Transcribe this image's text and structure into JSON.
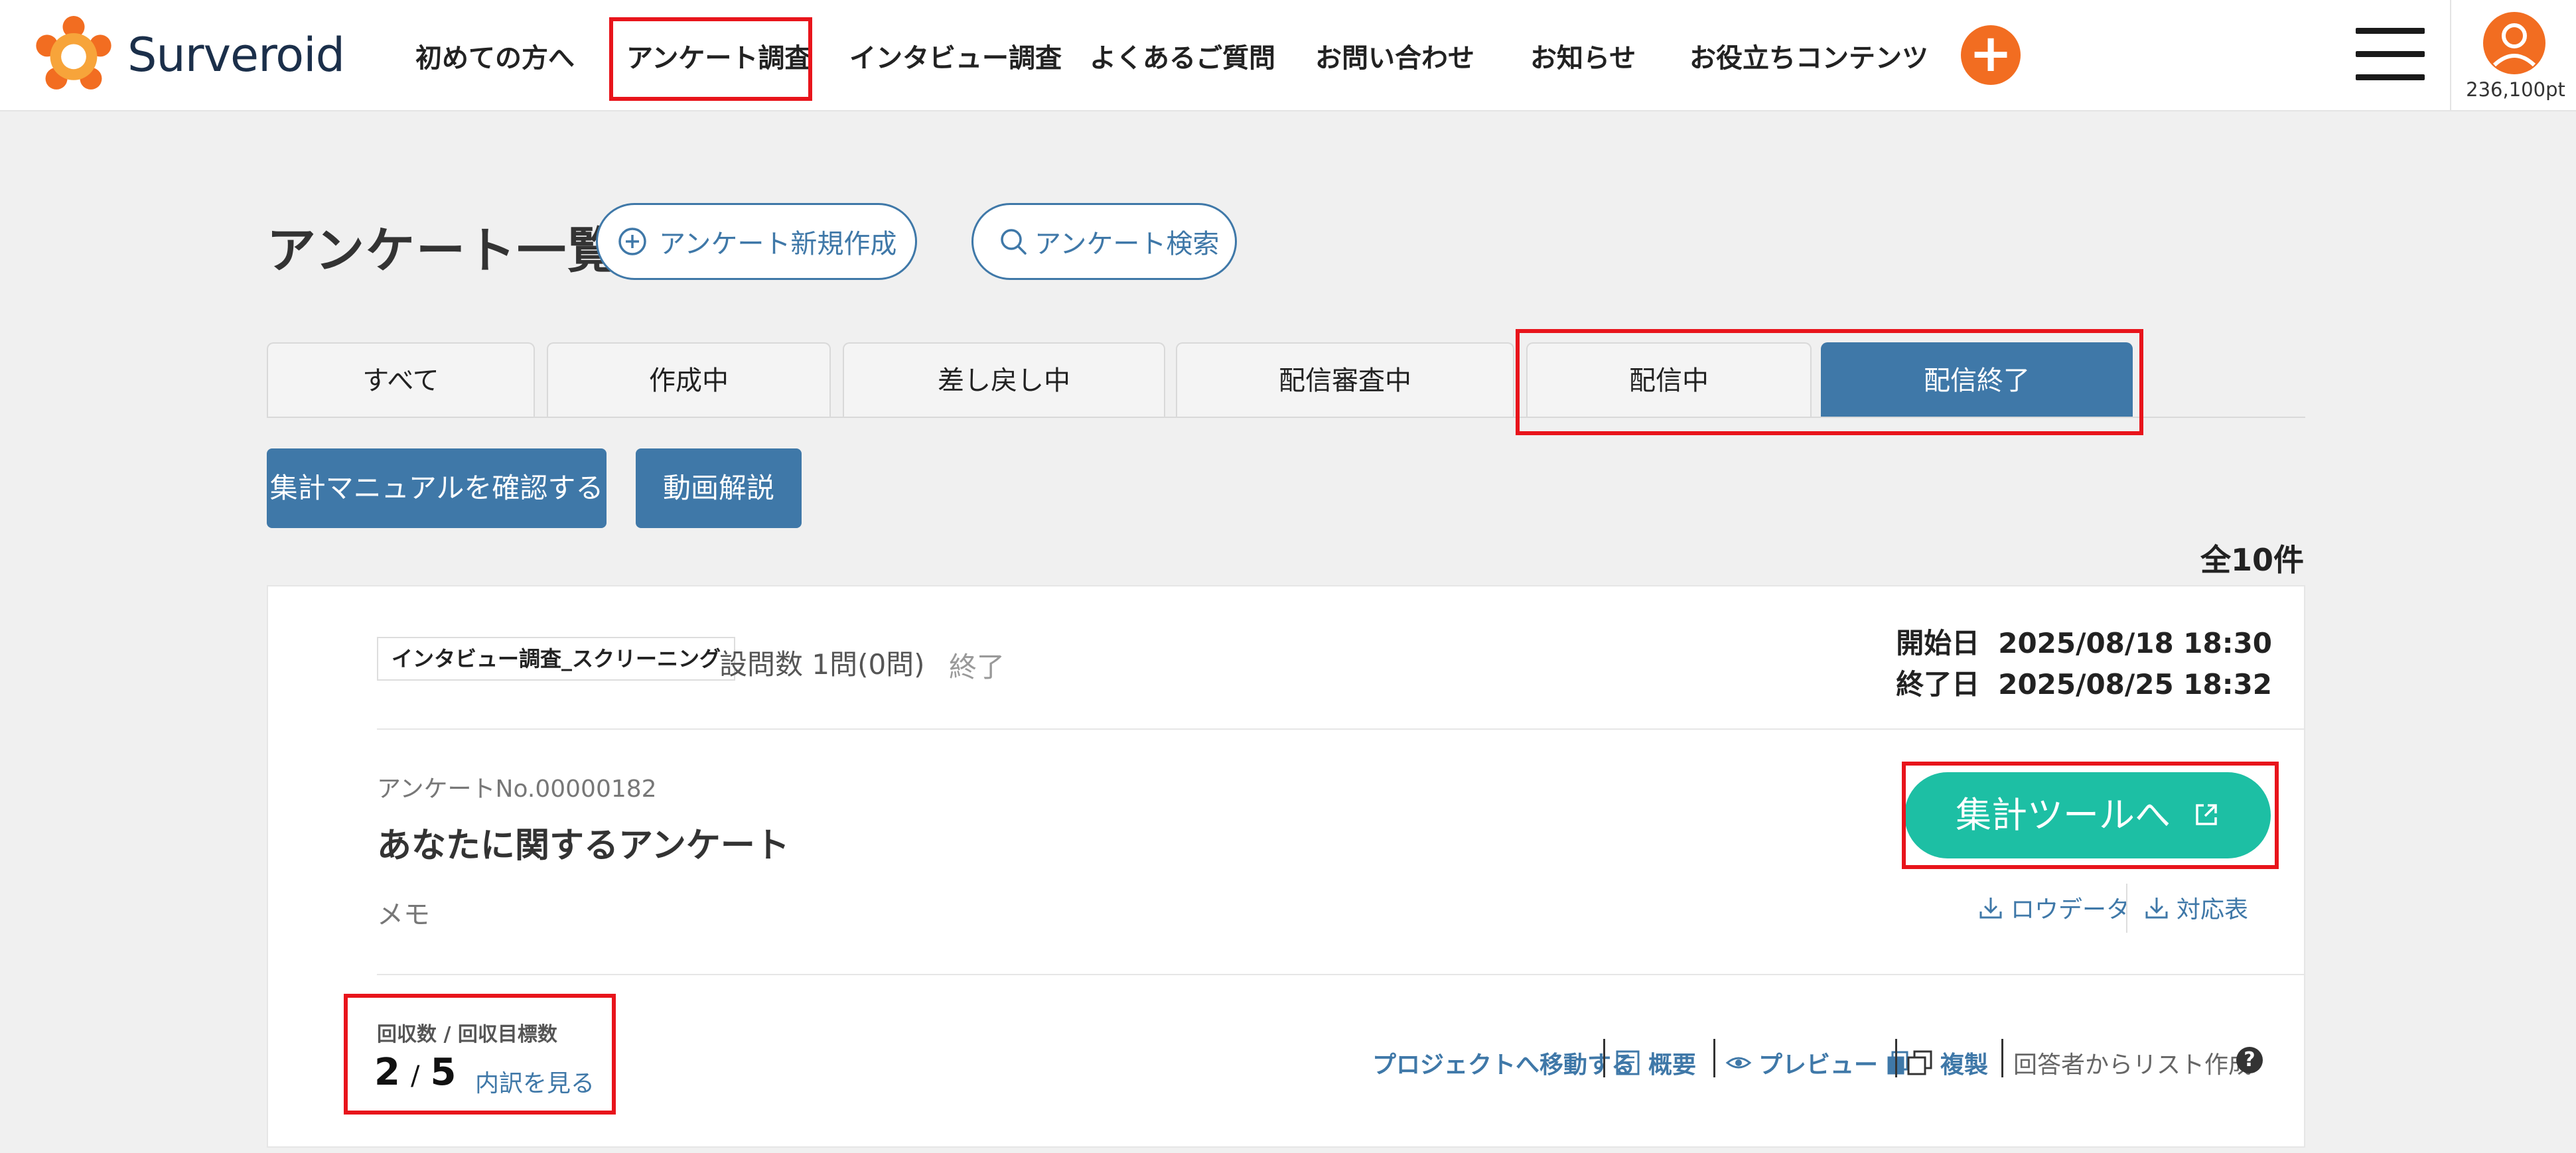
{
  "header": {
    "logo_text": "Surveroid",
    "nav": [
      {
        "label": "初めての方へ"
      },
      {
        "label": "アンケート調査"
      },
      {
        "label": "インタビュー調査"
      },
      {
        "label": "よくあるご質問"
      },
      {
        "label": "お問い合わせ"
      },
      {
        "label": "お知らせ"
      },
      {
        "label": "お役立ちコンテンツ"
      }
    ],
    "plus_label": "+",
    "points": "236,100pt"
  },
  "page": {
    "title": "アンケート一覧",
    "new_survey_label": "アンケート新規作成",
    "search_label": "アンケート検索"
  },
  "tabs": [
    {
      "label": "すべて"
    },
    {
      "label": "作成中"
    },
    {
      "label": "差し戻し中"
    },
    {
      "label": "配信審査中"
    },
    {
      "label": "配信中"
    },
    {
      "label": "配信終了"
    }
  ],
  "actions": {
    "manual_label": "集計マニュアルを確認する",
    "video_label": "動画解説",
    "total": "全10件"
  },
  "card": {
    "badge": "インタビュー調査_スクリーニング",
    "question_count": "設問数  1問(0問)",
    "status": "終了",
    "start_label": "開始日",
    "start_value": "2025/08/18 18:30",
    "end_label": "終了日",
    "end_value": "2025/08/25 18:32",
    "survey_no": "アンケートNo.00000182",
    "survey_title": "あなたに関するアンケート",
    "memo": "メモ",
    "tool_button": "集計ツールへ",
    "raw_data": "ロウデータ",
    "mapping": "対応表",
    "responses_label": "回収数 / 回収目標数",
    "responses_current": "2",
    "responses_slash": "/",
    "responses_target": "5",
    "breakdown_link": "内訳を見る",
    "footer": {
      "project": "プロジェクトへ移動する",
      "overview": "概要",
      "preview": "プレビュー",
      "duplicate": "複製",
      "list_create": "回答者からリスト作成",
      "help": "?"
    }
  },
  "colors": {
    "primary": "#3f78a8",
    "accent_orange": "#f26d21",
    "green": "#1dbfa4",
    "highlight_red": "#e8141b"
  }
}
